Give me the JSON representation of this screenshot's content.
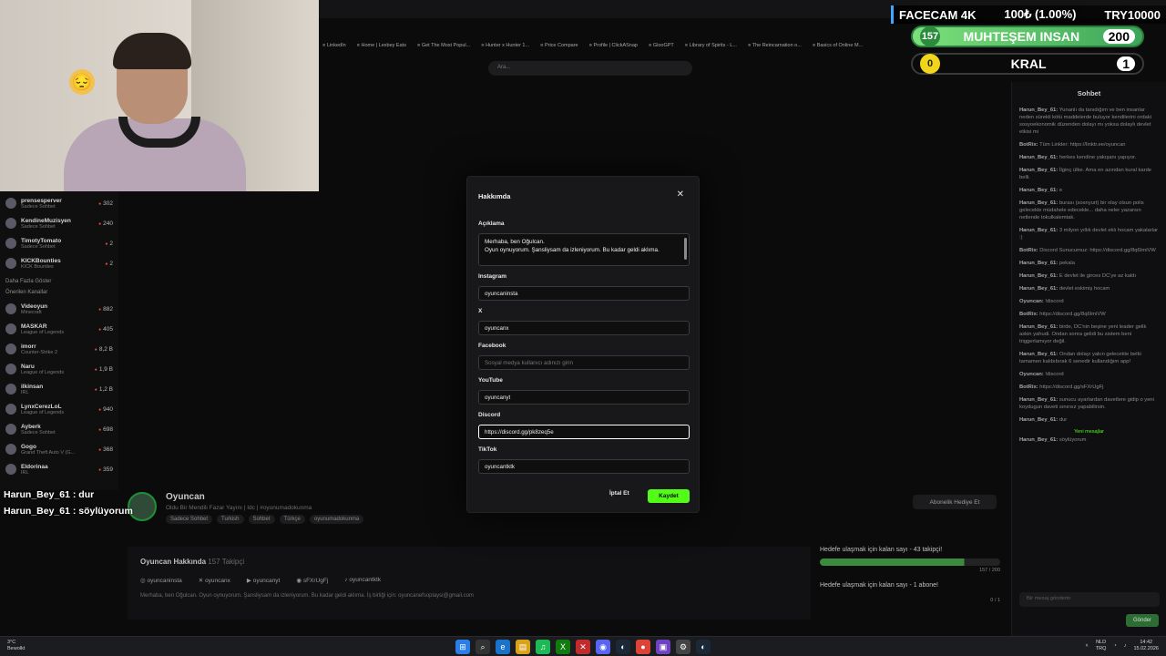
{
  "browser": {
    "bookmarks": [
      "LinkedIn",
      "Home | Lexbey Eats",
      "Get The Most Popul...",
      "Hunter x Hunter 1...",
      "Price Compare",
      "Profile | ClickASnap",
      "GlooGPT",
      "Library of Spirits - L...",
      "The Reincarnation o...",
      "Basics of Online M..."
    ],
    "search_placeholder": "Ara..."
  },
  "facecam": {
    "title": "FACECAM 4K",
    "progress": "100₺ (1.00%)",
    "target": "TRY10000",
    "goal1_left": "157",
    "goal1_name": "MUHTEŞEM INSAN",
    "goal1_right": "200",
    "goal2_left": "0",
    "goal2_name": "KRAL",
    "goal2_right": "1"
  },
  "sidebar": {
    "top_items": [
      {
        "name": "prensesperver",
        "cat": "Sadece Sohbet",
        "viewers": "302"
      },
      {
        "name": "KendineMuzisyen",
        "cat": "Sadece Sohbet",
        "viewers": "240"
      },
      {
        "name": "TimotyTomato",
        "cat": "Sadece Sohbet",
        "viewers": "2"
      },
      {
        "name": "KICKBounties",
        "cat": "KICK Bounties",
        "viewers": "2"
      }
    ],
    "more_label": "Daha Fazla Göster",
    "section_label": "Önerilen Kanallar",
    "items": [
      {
        "name": "Videoyun",
        "cat": "Minecraft",
        "viewers": "882"
      },
      {
        "name": "MASKAR",
        "cat": "League of Legends",
        "viewers": "405"
      },
      {
        "name": "imorr",
        "cat": "Counter-Strike 2",
        "viewers": "8,2 B"
      },
      {
        "name": "Naru",
        "cat": "League of Legends",
        "viewers": "1,9 B"
      },
      {
        "name": "ilkinsan",
        "cat": "IRL",
        "viewers": "1,2 B"
      },
      {
        "name": "LynxCerezLoL",
        "cat": "League of Legends",
        "viewers": "940"
      },
      {
        "name": "Ayberk",
        "cat": "Sadece Sohbet",
        "viewers": "698"
      },
      {
        "name": "Gogo",
        "cat": "Grand Theft Auto V (G...",
        "viewers": "368"
      },
      {
        "name": "Eldorinaa",
        "cat": "IRL",
        "viewers": "359"
      }
    ]
  },
  "overlay_chat": [
    "Harun_Bey_61 : dur",
    "Harun_Bey_61 : söylüyorum"
  ],
  "channel": {
    "name": "Oyuncan",
    "subtitle": "Oldu Bir Mendili Fazar Yayını | Idc | #oyunumadokunma",
    "tags": [
      "Sadece Sohbet",
      "Turkish",
      "Sohbet",
      "Türkçe",
      "oyunumadokunma"
    ],
    "sub_gift_label": "Abonelik Hediye Et",
    "about_title": "Oyuncan Hakkında",
    "followers": "157 Takipçi",
    "socials": [
      "oyuncaninsta",
      "oyuncanx",
      "oyuncanyt",
      "sFXrUgFj",
      "oyuncantktk"
    ],
    "bio": "Merhaba, ben Oğulcan. Oyun oynuyorum. Şansliysam da izleniyorum. Bu kadar geldi aklıma. İş birliği için: oyuncanefsoplaysi@gmail.com"
  },
  "goals": {
    "goal1": "Hedefe ulaşmak için kalan sayı - 43 takipçi!",
    "goal1_progress": "157 / 200",
    "goal2": "Hedefe ulaşmak için kalan sayı - 1 abone!",
    "goal2_progress": "0 / 1"
  },
  "chat": {
    "title": "Sohbet",
    "lines": [
      {
        "user": "Harun_Bey_61:",
        "text": "Yunanlı da tanıdığım ve ben insanlar neden sürekli kötü maddelerde buluyor kendilerini ordaki sosyoekonomik düzenden dolayı mı yoksa dolaylı devlet etkisi mi"
      },
      {
        "user": "BotRix:",
        "text": "Tüm Linkler: https://linktr.ee/oyuncan"
      },
      {
        "user": "Harun_Bey_61:",
        "text": "herkes kendine yakışanı yapıyor."
      },
      {
        "user": "Harun_Bey_61:",
        "text": "İlginç ülke. Ama en azından kural karde belli."
      },
      {
        "user": "Harun_Bey_61:",
        "text": "e"
      },
      {
        "user": "Harun_Bey_61:",
        "text": "burası (sosnyurt) bir olay olsun polis gelecekle müdahele edecekle... daha neler yazarsın netlende tokulkalemtak."
      },
      {
        "user": "Harun_Bey_61:",
        "text": "3 milyon yıllık devlet eklı hocam yakalarlar :)"
      },
      {
        "user": "BotRix:",
        "text": "Discord Sunucumuz: https://discord.gg/8q6ImiVW"
      },
      {
        "user": "Harun_Bey_61:",
        "text": "pekala"
      },
      {
        "user": "Harun_Bey_61:",
        "text": "E devlet ile girces DC'ye az kaldı"
      },
      {
        "user": "Harun_Bey_61:",
        "text": "devlet eskimiş hocam"
      },
      {
        "user": "Oyuncan:",
        "text": "!discord"
      },
      {
        "user": "BotRix:",
        "text": "https://discord.gg/8q6ImiVW"
      },
      {
        "user": "Harun_Bey_61:",
        "text": "birde, DC'nin beşine yeni leader gelik askin yahudi. Ondan sonra gelidi bu sistem beni triggerlamıyor değil."
      },
      {
        "user": "Harun_Bey_61:",
        "text": "Ondan dolayı yakın gelecekte belki tamamen kalıbıbırak 6 senedir kullandığım app!"
      },
      {
        "user": "Oyuncan:",
        "text": "!discord"
      },
      {
        "user": "BotRix:",
        "text": "https://discord.gg/sFXrUgFj"
      },
      {
        "user": "Harun_Bey_61:",
        "text": "sunucu ayarlardan davetlere gidip o yeni koydugun daveti sınırsız yapabilirsin."
      },
      {
        "user": "Harun_Bey_61:",
        "text": "dur"
      }
    ],
    "new_messages": "Yeni mesajlar",
    "last_line_user": "Harun_Bey_61:",
    "last_line_text": "söylüyorum",
    "input_placeholder": "Bir mesaj gönderin",
    "send_label": "Gönder"
  },
  "modal": {
    "title": "Hakkımda",
    "description_label": "Açıklama",
    "description_value": "Merhaba, ben Oğulcan.\nOyun oynuyorum. Şansliysam da izleniyorum. Bu kadar geldi aklıma.",
    "instagram_label": "Instagram",
    "instagram_value": "oyuncaninsta",
    "x_label": "X",
    "x_value": "oyuncanx",
    "facebook_label": "Facebook",
    "facebook_placeholder": "Sosyal medya kullanıcı adınızı girin",
    "youtube_label": "YouTube",
    "youtube_value": "oyuncanyt",
    "discord_label": "Discord",
    "discord_value": "https://discord.gg/pk8zeq5e",
    "tiktok_label": "TikTok",
    "tiktok_value": "oyuncantktk",
    "cancel_label": "İptal Et",
    "save_label": "Kaydet"
  },
  "taskbar": {
    "temp": "3°C",
    "weather": "Bewolkt",
    "lang_top": "NLD",
    "lang_bottom": "TRQ",
    "time": "14:42",
    "date": "15.02.2026"
  },
  "colors": {
    "accent": "#53fc18",
    "modal_bg": "#18181a",
    "page_bg": "#0b0b0c"
  }
}
